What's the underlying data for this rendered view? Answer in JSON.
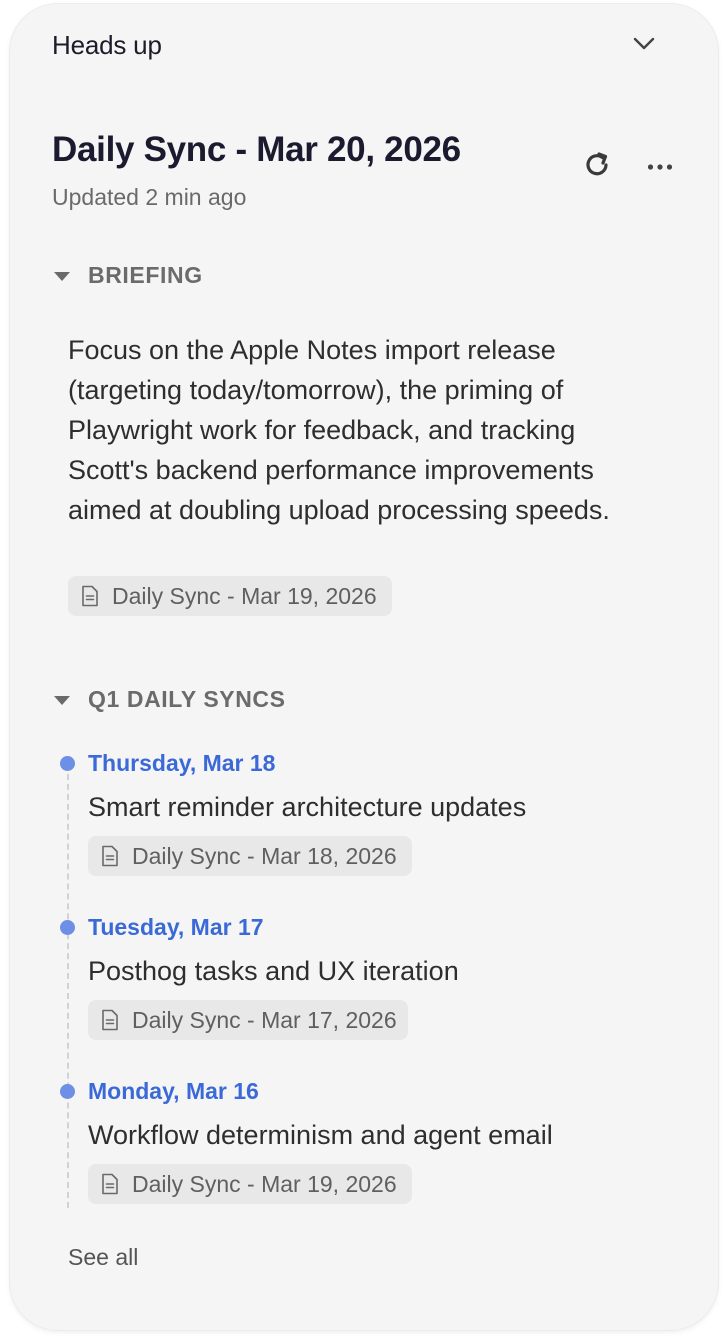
{
  "header": {
    "label": "Heads up",
    "collapse_icon": "chevron-down-icon"
  },
  "meeting": {
    "title": "Daily Sync - Mar 20, 2026",
    "updated": "Updated 2 min ago",
    "refresh_icon": "refresh-icon",
    "more_icon": "more-horizontal-icon"
  },
  "briefing": {
    "label": "BRIEFING",
    "text": "Focus on the Apple Notes import release (targeting today/tomorrow), the priming of Playwright work for feedback, and tracking Scott's backend performance improvements aimed at doubling upload processing speeds.",
    "source": "Daily Sync - Mar 19, 2026"
  },
  "q1": {
    "label": "Q1 DAILY SYNCS",
    "items": [
      {
        "date": "Thursday, Mar 18",
        "title": "Smart reminder architecture updates",
        "source": "Daily Sync - Mar 18, 2026"
      },
      {
        "date": "Tuesday, Mar 17",
        "title": "Posthog tasks and UX iteration",
        "source": "Daily Sync - Mar 17, 2026"
      },
      {
        "date": "Monday, Mar 16",
        "title": "Workflow determinism and agent email",
        "source": "Daily Sync - Mar 19, 2026"
      }
    ],
    "see_all": "See all"
  },
  "colors": {
    "panel_bg": "#f5f5f5",
    "accent_blue": "#3b6ad8",
    "dot_blue": "#6e8fe6",
    "chip_bg": "#e8e8e8"
  }
}
